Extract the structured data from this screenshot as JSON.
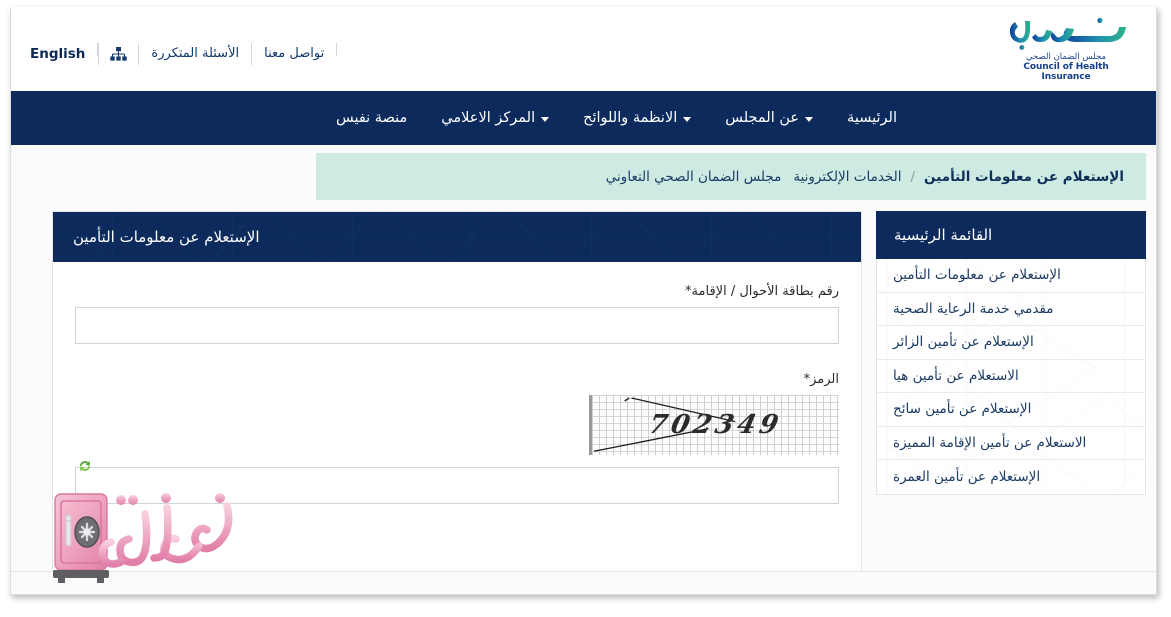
{
  "topbar": {
    "english_label": "English",
    "sitemap_icon": "sitemap-icon",
    "faq_label": "الأسئلة المتكررة",
    "contact_label": "تواصل معنا"
  },
  "logo": {
    "wordmark": "ضمان",
    "arabic_subtitle": "مجلس الضمان الصحي",
    "english_subtitle": "Council of Health Insurance",
    "gradient_start": "#0b3d91",
    "gradient_end": "#2db389"
  },
  "nav": {
    "hamburger_icon": "hamburger-menu-icon",
    "grid_icon": "apps-grid-icon",
    "items": [
      {
        "label": "الرئيسية",
        "has_dropdown": false
      },
      {
        "label": "عن المجلس",
        "has_dropdown": true
      },
      {
        "label": "الانظمة واللوائح",
        "has_dropdown": true
      },
      {
        "label": "المركز الاعلامي",
        "has_dropdown": true
      },
      {
        "label": "منصة نفيس",
        "has_dropdown": false
      }
    ],
    "background": "#0c2a5b"
  },
  "breadcrumb": {
    "root": "مجلس الضمان الصحي التعاوني",
    "section": "الخدمات الإلكترونية",
    "separator": "/",
    "current": "الإستعلام عن معلومات التأمين",
    "background": "#cdeae3"
  },
  "sidebar": {
    "title": "القائمة الرئيسية",
    "items": [
      {
        "label": "الإستعلام عن معلومات التأمين"
      },
      {
        "label": "مقدمي خدمة الرعاية الصحية"
      },
      {
        "label": "الإستعلام عن تأمين الزائر"
      },
      {
        "label": "الاستعلام عن تأمين هيا"
      },
      {
        "label": "الإستعلام عن تأمين سائح"
      },
      {
        "label": "الاستعلام عن تأمين الإقامة المميزة"
      },
      {
        "label": "الإستعلام عن تأمين العمرة"
      }
    ]
  },
  "form": {
    "title": "الإستعلام عن معلومات التأمين",
    "id_label": "رقم بطاقة الأحوال / الإقامة*",
    "id_value": "",
    "id_placeholder": "",
    "captcha_label": "الرمز*",
    "captcha_code": "702349",
    "captcha_value": "",
    "captcha_placeholder": "",
    "refresh_icon": "refresh-captcha-icon"
  },
  "watermark": {
    "text": "خزنة",
    "icon": "safe-vault-icon",
    "color": "#e58aad"
  }
}
